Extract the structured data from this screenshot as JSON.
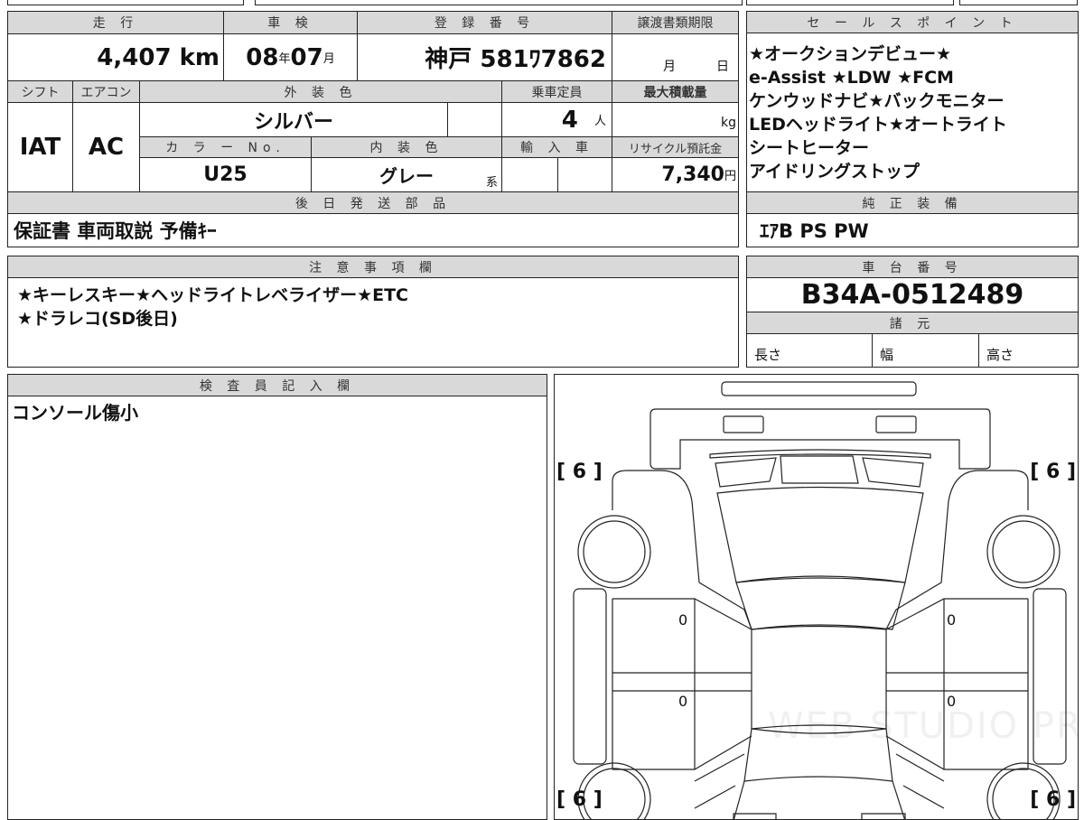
{
  "vehicle": {
    "mileage_label": "走 行",
    "mileage": "4,407",
    "mileage_unit": "km",
    "inspection_label": "車 検",
    "inspection_year": "08",
    "year_unit": "年",
    "inspection_month": "07",
    "month_unit": "月",
    "registration_label": "登 録 番 号",
    "registration": "神戸 581ﾜ7862",
    "transfer_label": "譲渡書類期限",
    "transfer_month_unit": "月",
    "transfer_day_unit": "日",
    "shift_label": "シフト",
    "shift": "IAT",
    "ac_label": "エアコン",
    "ac": "AC",
    "exterior_label": "外 装 色",
    "exterior": "シルバー",
    "capacity_label": "乗車定員",
    "capacity": "4",
    "capacity_unit": "人",
    "max_load_label": "最大積載量",
    "max_load_unit": "kg",
    "color_no_label": "カ ラ ー No.",
    "color_no": "U25",
    "interior_label": "内 装 色",
    "interior": "グレー",
    "interior_suffix": "系",
    "import_label": "輸 入 車",
    "recycle_label": "リサイクル預託金",
    "recycle": "7,340",
    "recycle_unit": "円",
    "later_parts_label": "後 日 発 送 部 品",
    "later_parts": "保証書 車両取説 予備ｷｰ"
  },
  "sales_points": {
    "label": "セ ー ル ス ポ イ ン ト",
    "lines": [
      "★オークションデビュー★",
      "e-Assist ★LDW ★FCM",
      "ケンウッドナビ★バックモニター",
      "LEDヘッドライト★オートライト",
      "シートヒーター",
      "アイドリングストップ"
    ]
  },
  "equipment": {
    "label": "純 正 装 備",
    "value": "ｴｱB PS PW"
  },
  "notes": {
    "label": "注 意 事 項 欄",
    "lines": [
      "★キーレスキー★ヘッドライトレベライザー★ETC",
      "★ドラレコ(SD後日)"
    ]
  },
  "chassis": {
    "label": "車 台 番 号",
    "value": "B34A-0512489",
    "spec_label": "諸 元",
    "length": "長さ",
    "width": "幅",
    "height": "高さ"
  },
  "inspector": {
    "label": "検 査 員 記 入 欄",
    "value": "コンソール傷小"
  },
  "diagram": {
    "tire_tread": [
      "6",
      "6",
      "6",
      "6"
    ],
    "door_marks": [
      "0",
      "0",
      "0",
      "0"
    ],
    "watermark": "WEB STUDIO PRO"
  }
}
